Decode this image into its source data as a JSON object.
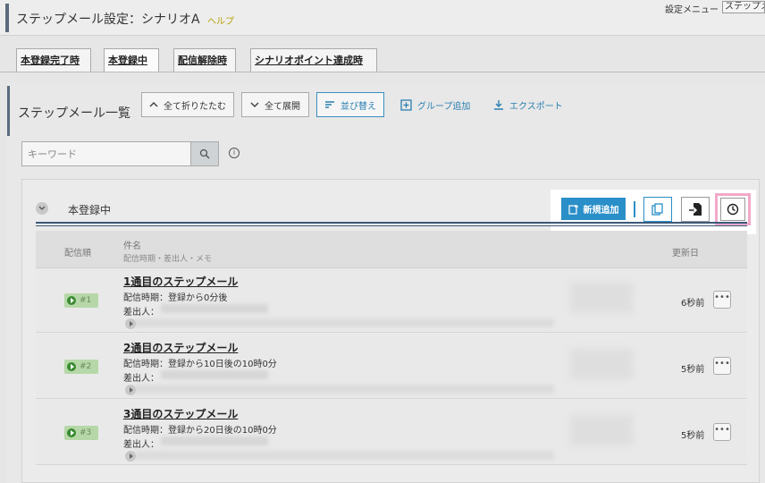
{
  "header": {
    "title": "ステップメール設定：シナリオA",
    "help_label": "ヘルプ",
    "settings_menu_label": "設定メニュー",
    "step_select_value": "ステップメ"
  },
  "tabs": [
    {
      "label": "本登録完了時"
    },
    {
      "label": "本登録中"
    },
    {
      "label": "配信解除時"
    },
    {
      "label": "シナリオポイント達成時"
    }
  ],
  "list": {
    "title": "ステップメール一覧",
    "collapse_all_label": "全て折りたたむ",
    "expand_all_label": "全て展開",
    "sort_label": "並び替え",
    "add_group_label": "グループ追加",
    "export_label": "エクスポート"
  },
  "search": {
    "placeholder": "キーワード",
    "info_symbol": "i"
  },
  "group": {
    "name": "本登録中",
    "add_new_label": "新規追加",
    "columns": {
      "order": "配信順",
      "name": "件名",
      "name_sub": "配信時期・差出人・メモ",
      "updated": "更新日"
    },
    "rows": [
      {
        "order": "#1",
        "title": "1通目のステップメール",
        "timing": "配信時期：登録から0分後",
        "sender": "差出人：",
        "updated": "6秒前",
        "more": "•••"
      },
      {
        "order": "#2",
        "title": "2通目のステップメール",
        "timing": "配信時期：登録から10日後の10時0分",
        "sender": "差出人：",
        "updated": "5秒前",
        "more": "•••"
      },
      {
        "order": "#3",
        "title": "3通目のステップメール",
        "timing": "配信時期：登録から20日後の10時0分",
        "sender": "差出人：",
        "updated": "5秒前",
        "more": "•••"
      }
    ]
  },
  "colors": {
    "accent_blue": "#2a8fc8",
    "highlight_pink": "#f2a8c8",
    "status_green": "#3a8a32"
  }
}
